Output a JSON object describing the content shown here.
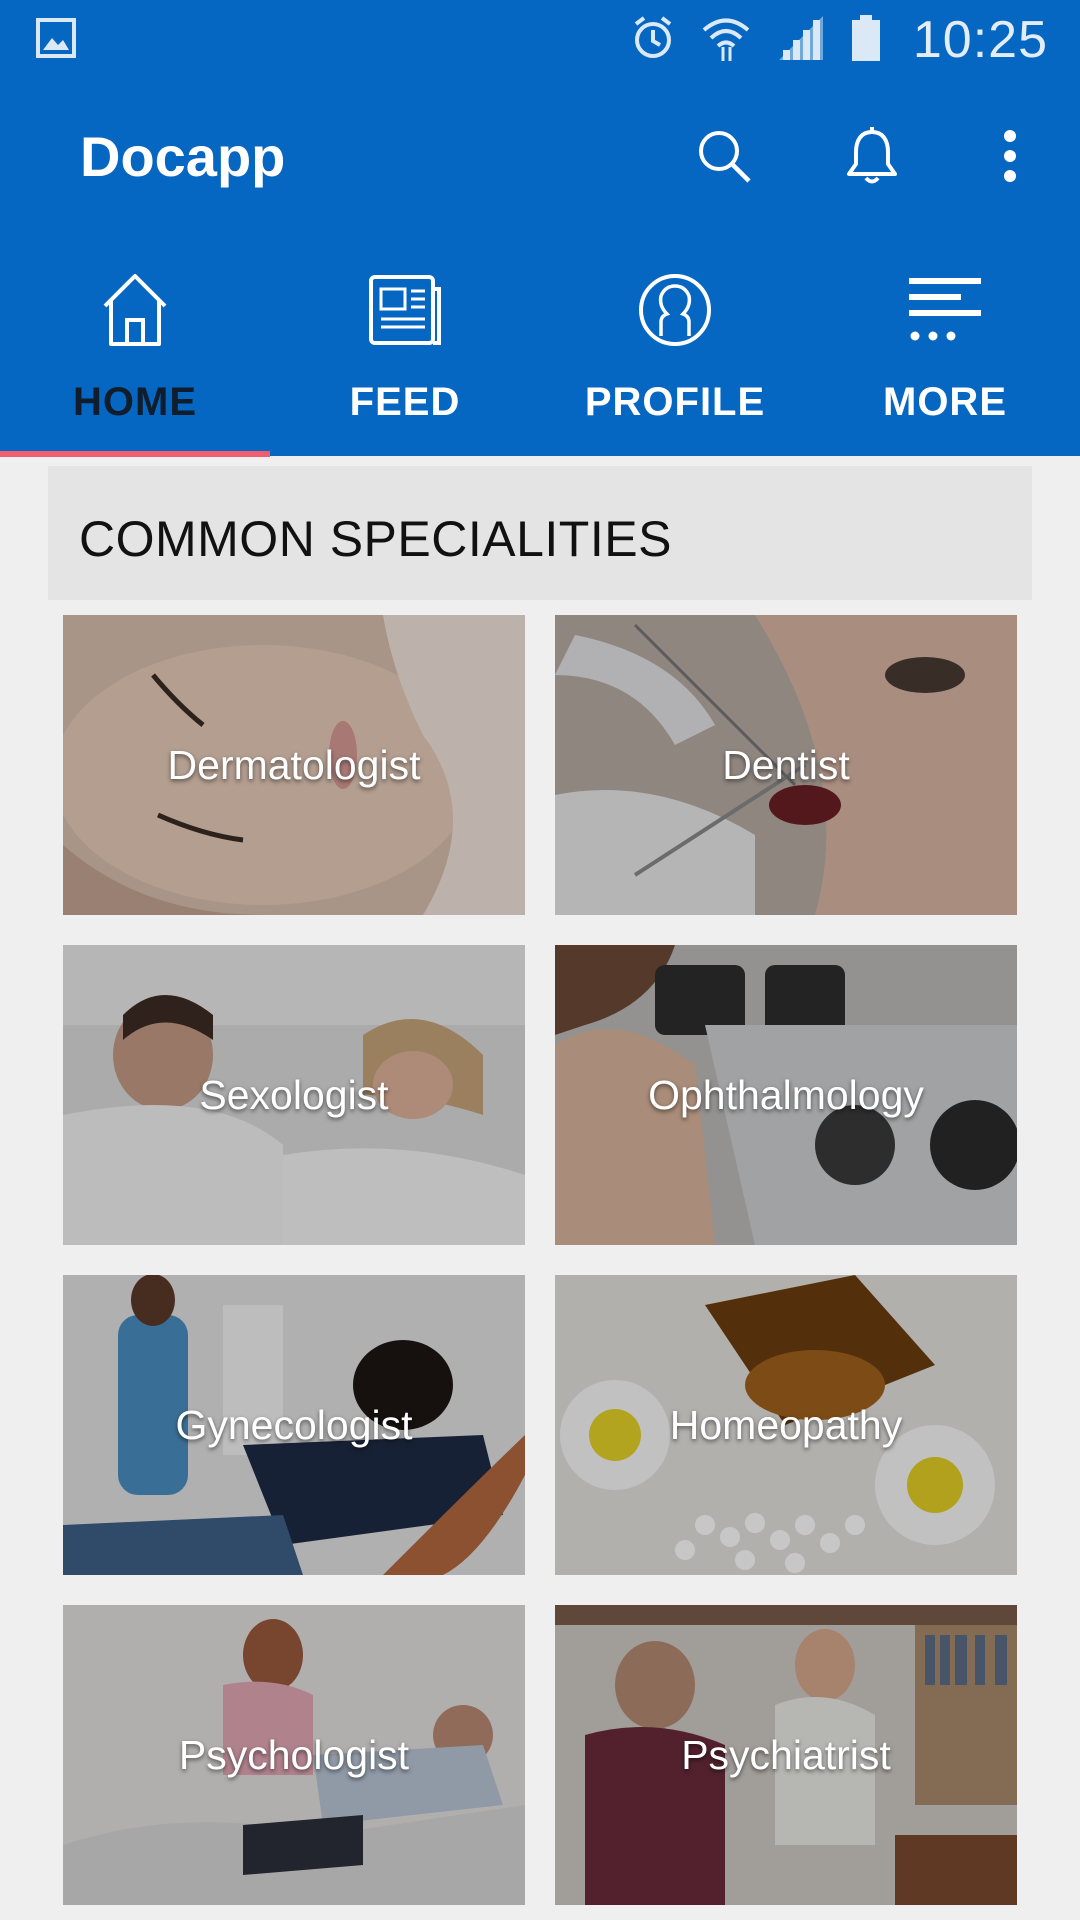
{
  "status_bar": {
    "time": "10:25",
    "icons": [
      "image-icon",
      "alarm-icon",
      "wifi-icon",
      "signal-icon",
      "battery-icon"
    ]
  },
  "toolbar": {
    "title": "Docapp",
    "actions": [
      "search-icon",
      "bell-icon",
      "more-vert-icon"
    ]
  },
  "tabs": [
    {
      "label": "HOME",
      "icon": "home-icon",
      "active": true
    },
    {
      "label": "FEED",
      "icon": "newspaper-icon",
      "active": false
    },
    {
      "label": "PROFILE",
      "icon": "person-icon",
      "active": false
    },
    {
      "label": "MORE",
      "icon": "more-menu-icon",
      "active": false
    }
  ],
  "section": {
    "title": "COMMON SPECIALITIES"
  },
  "specialities": [
    {
      "label": "Dermatologist"
    },
    {
      "label": "Dentist"
    },
    {
      "label": "Sexologist"
    },
    {
      "label": "Ophthalmology"
    },
    {
      "label": "Gynecologist"
    },
    {
      "label": "Homeopathy"
    },
    {
      "label": "Psychologist"
    },
    {
      "label": "Psychiatrist"
    }
  ],
  "colors": {
    "primary": "#0667c2",
    "tab_indicator": "#ef5d6f",
    "background": "#efefef",
    "section_header_bg": "#e4e4e4"
  }
}
